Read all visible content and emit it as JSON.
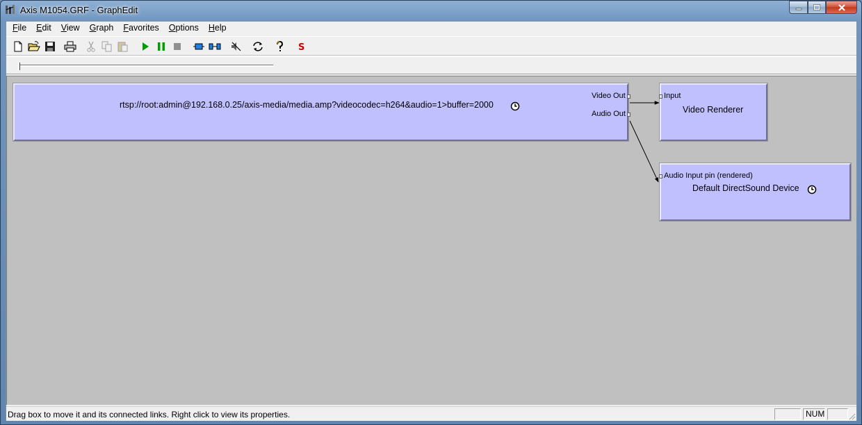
{
  "window": {
    "title": "Axis M1054.GRF - GraphEdit"
  },
  "menubar": {
    "items": [
      {
        "label": "File",
        "accel": "F",
        "rest": "ile"
      },
      {
        "label": "Edit",
        "accel": "E",
        "rest": "dit"
      },
      {
        "label": "View",
        "accel": "V",
        "rest": "iew"
      },
      {
        "label": "Graph",
        "accel": "G",
        "rest": "raph"
      },
      {
        "label": "Favorites",
        "accel": "F",
        "rest": "avorites"
      },
      {
        "label": "Options",
        "accel": "O",
        "rest": "ptions"
      },
      {
        "label": "Help",
        "accel": "H",
        "rest": "elp"
      }
    ]
  },
  "toolbar": {
    "buttons": [
      "new-icon",
      "open-icon",
      "save-icon",
      "print-icon",
      "cut-icon",
      "copy-icon",
      "paste-icon",
      "play-icon",
      "pause-icon",
      "stop-icon",
      "filter-icon",
      "connect-icon",
      "mute-icon",
      "refresh-icon",
      "help-icon",
      "seek-icon"
    ]
  },
  "graph": {
    "filters": [
      {
        "name": "rtsp://root:admin@192.168.0.25/axis-media/media.amp?videocodec=h264&audio=1>buffer=2000",
        "pins": [
          "Video Out",
          "Audio Out"
        ],
        "has_clock": true
      },
      {
        "name": "Video Renderer",
        "pins": [
          "Input"
        ],
        "has_clock": false
      },
      {
        "name": "Default DirectSound Device",
        "pins": [
          "Audio Input pin (rendered)"
        ],
        "has_clock": true
      }
    ],
    "links": [
      {
        "from": "Video Out",
        "to": "Input"
      },
      {
        "from": "Audio Out",
        "to": "Audio Input pin (rendered)"
      }
    ]
  },
  "statusbar": {
    "text": "Drag box to move it and its connected links. Right click to view its properties.",
    "num": "NUM"
  },
  "colors": {
    "filter_fill": "#c0c0ff",
    "canvas": "#c0c0c0"
  }
}
